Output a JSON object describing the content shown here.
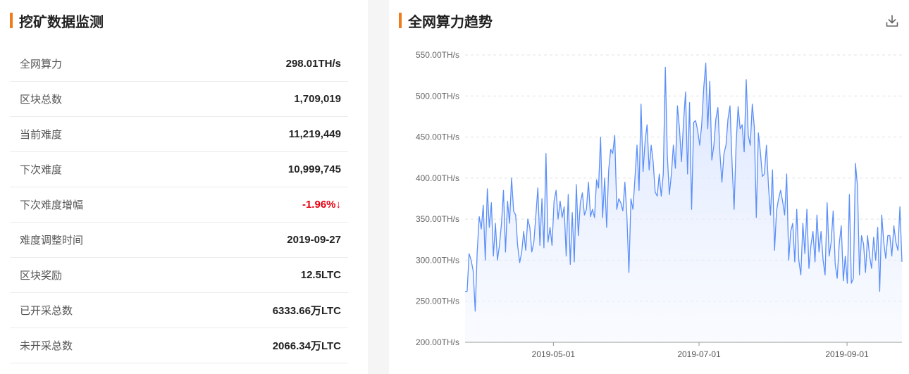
{
  "left_panel": {
    "title": "挖矿数据监测",
    "stats": [
      {
        "label": "全网算力",
        "value": "298.01TH/s",
        "negative": false
      },
      {
        "label": "区块总数",
        "value": "1,709,019",
        "negative": false
      },
      {
        "label": "当前难度",
        "value": "11,219,449",
        "negative": false
      },
      {
        "label": "下次难度",
        "value": "10,999,745",
        "negative": false
      },
      {
        "label": "下次难度增幅",
        "value": "-1.96%↓",
        "negative": true
      },
      {
        "label": "难度调整时间",
        "value": "2019-09-27",
        "negative": false
      },
      {
        "label": "区块奖励",
        "value": "12.5LTC",
        "negative": false
      },
      {
        "label": "已开采总数",
        "value": "6333.66万LTC",
        "negative": false
      },
      {
        "label": "未开采总数",
        "value": "2066.34万LTC",
        "negative": false
      }
    ]
  },
  "right_panel": {
    "title": "全网算力趋势",
    "download_icon": "download-icon"
  },
  "colors": {
    "accent": "#f07b1d",
    "line": "#5b8ff9",
    "area_top": "#d6e2ff",
    "negative": "#e60012"
  },
  "chart_data": {
    "type": "area",
    "title": "全网算力趋势",
    "xlabel": "",
    "ylabel": "",
    "y_unit": "TH/s",
    "ylim": [
      200,
      550
    ],
    "y_ticks": [
      "200.00TH/s",
      "250.00TH/s",
      "300.00TH/s",
      "350.00TH/s",
      "400.00TH/s",
      "450.00TH/s",
      "500.00TH/s",
      "550.00TH/s"
    ],
    "x_ticks": [
      "2019-05-01",
      "2019-07-01",
      "2019-09-01"
    ],
    "grid": true,
    "x_start": "2019-03-25",
    "x_end": "2019-09-24",
    "series": [
      {
        "name": "全网算力",
        "values": [
          262,
          262,
          308,
          300,
          287,
          238,
          310,
          353,
          338,
          367,
          300,
          387,
          340,
          370,
          305,
          345,
          300,
          318,
          345,
          385,
          310,
          372,
          345,
          400,
          360,
          355,
          318,
          297,
          310,
          335,
          312,
          350,
          340,
          310,
          322,
          355,
          388,
          318,
          375,
          315,
          430,
          322,
          340,
          318,
          372,
          385,
          350,
          372,
          352,
          365,
          305,
          380,
          295,
          358,
          298,
          392,
          330,
          370,
          382,
          355,
          362,
          395,
          353,
          362,
          352,
          398,
          388,
          450,
          352,
          400,
          340,
          410,
          435,
          430,
          452,
          362,
          375,
          370,
          360,
          395,
          355,
          285,
          375,
          362,
          400,
          440,
          385,
          490,
          408,
          445,
          465,
          410,
          440,
          420,
          383,
          378,
          405,
          378,
          405,
          535,
          428,
          380,
          405,
          440,
          412,
          488,
          460,
          420,
          468,
          505,
          405,
          492,
          362,
          468,
          470,
          458,
          440,
          465,
          510,
          540,
          460,
          518,
          422,
          440,
          472,
          486,
          430,
          395,
          430,
          440,
          472,
          488,
          418,
          362,
          440,
          487,
          460,
          465,
          432,
          520,
          452,
          440,
          490,
          462,
          352,
          455,
          432,
          402,
          405,
          440,
          390,
          355,
          410,
          312,
          360,
          375,
          385,
          372,
          355,
          405,
          300,
          335,
          345,
          298,
          362,
          300,
          282,
          345,
          308,
          362,
          290,
          318,
          335,
          298,
          355,
          310,
          335,
          300,
          282,
          370,
          305,
          322,
          360,
          295,
          278,
          320,
          342,
          275,
          305,
          272,
          380,
          272,
          278,
          418,
          390,
          282,
          330,
          320,
          285,
          330,
          305,
          290,
          328,
          300,
          340,
          262,
          355,
          322,
          302,
          330,
          330,
          305,
          342,
          322,
          312,
          365,
          298
        ]
      }
    ]
  }
}
